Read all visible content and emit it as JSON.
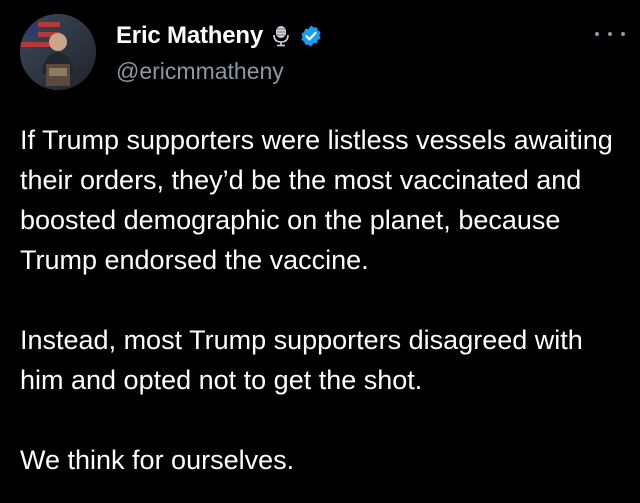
{
  "user": {
    "display_name": "Eric Matheny",
    "handle": "@ericmmatheny",
    "verified_color": "#1d9bf0",
    "badges": [
      "microphone-icon",
      "verified-badge-icon"
    ]
  },
  "actions": {
    "more_icon": "more-options-icon"
  },
  "tweet": {
    "paragraphs": [
      "If Trump supporters were listless vessels awaiting their orders, they’d be the most vaccinated and boosted demographic on the planet, because Trump endorsed the vaccine.",
      "Instead, most Trump supporters disagreed with him and opted not to get the shot.",
      "We think for ourselves."
    ]
  },
  "colors": {
    "background": "#000000",
    "text": "#ffffff",
    "secondary": "#8b98a5"
  }
}
